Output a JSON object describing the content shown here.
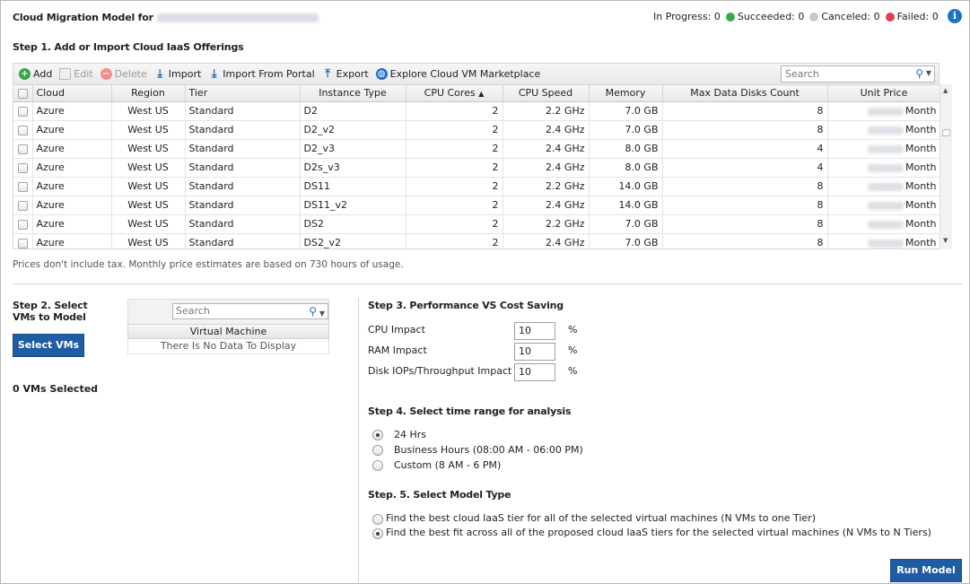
{
  "header": {
    "title": "Cloud Migration Model for",
    "status": [
      {
        "label": "In Progress: 0",
        "color": ""
      },
      {
        "label": "Succeeded: 0",
        "color": "#39a94a"
      },
      {
        "label": "Canceled: 0",
        "color": "#c9c9c9"
      },
      {
        "label": "Failed: 0",
        "color": "#e2404e"
      }
    ],
    "info_icon": "info-icon"
  },
  "step1": {
    "title": "Step 1. Add or Import Cloud IaaS Offerings",
    "toolbar": {
      "add": "Add",
      "edit": "Edit",
      "delete": "Delete",
      "import": "Import",
      "import_portal": "Import From Portal",
      "export": "Export",
      "explore": "Explore Cloud VM Marketplace"
    },
    "search_placeholder": "Search",
    "columns": [
      "Cloud",
      "Region",
      "Tier",
      "Instance Type",
      "CPU Cores",
      "CPU Speed",
      "Memory",
      "Max Data Disks Count",
      "Unit Price"
    ],
    "sort_indicator": "▲",
    "rows": [
      {
        "cloud": "Azure",
        "region": "West US",
        "tier": "Standard",
        "instance": "D2",
        "cores": "2",
        "speed": "2.2 GHz",
        "memory": "7.0 GB",
        "disks": "8",
        "price": "Month"
      },
      {
        "cloud": "Azure",
        "region": "West US",
        "tier": "Standard",
        "instance": "D2_v2",
        "cores": "2",
        "speed": "2.4 GHz",
        "memory": "7.0 GB",
        "disks": "8",
        "price": "Month"
      },
      {
        "cloud": "Azure",
        "region": "West US",
        "tier": "Standard",
        "instance": "D2_v3",
        "cores": "2",
        "speed": "2.4 GHz",
        "memory": "8.0 GB",
        "disks": "4",
        "price": "Month"
      },
      {
        "cloud": "Azure",
        "region": "West US",
        "tier": "Standard",
        "instance": "D2s_v3",
        "cores": "2",
        "speed": "2.4 GHz",
        "memory": "8.0 GB",
        "disks": "4",
        "price": "Month"
      },
      {
        "cloud": "Azure",
        "region": "West US",
        "tier": "Standard",
        "instance": "DS11",
        "cores": "2",
        "speed": "2.2 GHz",
        "memory": "14.0 GB",
        "disks": "8",
        "price": "Month"
      },
      {
        "cloud": "Azure",
        "region": "West US",
        "tier": "Standard",
        "instance": "DS11_v2",
        "cores": "2",
        "speed": "2.4 GHz",
        "memory": "14.0 GB",
        "disks": "8",
        "price": "Month"
      },
      {
        "cloud": "Azure",
        "region": "West US",
        "tier": "Standard",
        "instance": "DS2",
        "cores": "2",
        "speed": "2.2 GHz",
        "memory": "7.0 GB",
        "disks": "8",
        "price": "Month"
      },
      {
        "cloud": "Azure",
        "region": "West US",
        "tier": "Standard",
        "instance": "DS2_v2",
        "cores": "2",
        "speed": "2.4 GHz",
        "memory": "7.0 GB",
        "disks": "8",
        "price": "Month"
      }
    ],
    "note": "Prices don't include tax. Monthly price estimates are based on 730 hours of usage."
  },
  "step2": {
    "title": "Step 2. Select VMs to Model",
    "button": "Select VMs",
    "search_placeholder": "Search",
    "column": "Virtual Machine",
    "empty": "There Is No Data To Display",
    "selected": "0 VMs Selected"
  },
  "step3": {
    "title": "Step 3. Performance VS Cost Saving",
    "fields": [
      {
        "label": "CPU Impact",
        "value": "10",
        "unit": "%"
      },
      {
        "label": "RAM Impact",
        "value": "10",
        "unit": "%"
      },
      {
        "label": "Disk IOPs/Throughput Impact",
        "value": "10",
        "unit": "%"
      }
    ]
  },
  "step4": {
    "title": "Step 4. Select time range for analysis",
    "options": [
      "24 Hrs",
      "Business Hours (08:00 AM - 06:00 PM)",
      "Custom (8 AM - 6 PM)"
    ],
    "selected": 0
  },
  "step5": {
    "title": "Step. 5. Select Model Type",
    "options": [
      "Find the best cloud IaaS tier for all of the selected virtual machines (N VMs to one Tier)",
      "Find the best fit across all of the proposed cloud IaaS tiers for the selected virtual machines (N VMs to N Tiers)"
    ],
    "selected": 1
  },
  "run_button": "Run Model"
}
